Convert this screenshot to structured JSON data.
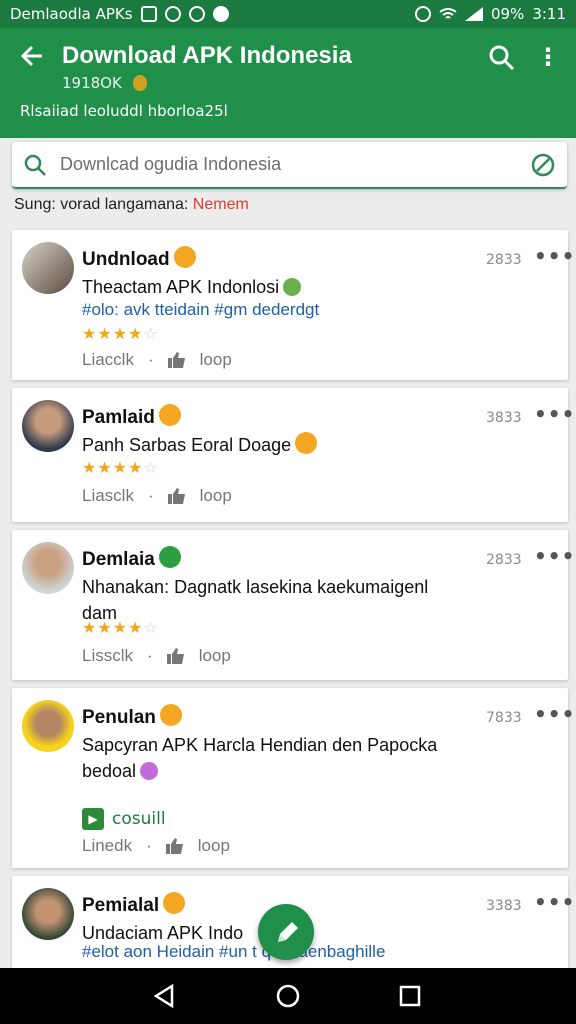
{
  "status": {
    "left_text": "Demlaodla APKs",
    "battery": "09%",
    "time": "3:11"
  },
  "appbar": {
    "title": "Download APK Indonesia",
    "subtitle": "1918OK",
    "description": "Rlsaiiad leoluddl hborloa25l"
  },
  "search": {
    "placeholder": "Downlcad ogudia Indonesia"
  },
  "filter": {
    "label": "Sung: vorad langamana:",
    "value": "Nemem"
  },
  "posts": [
    {
      "name": "Undnload",
      "date": "2833",
      "text": "Theactam APK Indonlosi",
      "tags": "#olo: avk tteidain #gm dederdgt",
      "rating": 4,
      "action_label": "Liacclk",
      "like_label": "loop"
    },
    {
      "name": "Pamlaid",
      "date": "3833",
      "text": "Panh Sarbas Eoral Doage",
      "rating": 4,
      "action_label": "Liasclk",
      "like_label": "loop"
    },
    {
      "name": "Demlaia",
      "date": "2833",
      "text": "Nhanakan: Dagnatk lasekina kaekumaigenl dam",
      "rating": 4,
      "action_label": "Lissclk",
      "like_label": "loop"
    },
    {
      "name": "Penulan",
      "date": "7833",
      "text": "Sapcyran APK Harcla Hendian den Papocka bedoal",
      "link_label": "cosuill",
      "action_label": "Linedk",
      "like_label": "loop"
    },
    {
      "name": "Pemialal",
      "date": "3383",
      "text": "Undaciam APK Indo",
      "tags": "#elot aon Heidain #un t qaukaenbaghille"
    }
  ],
  "colors": {
    "primary": "#1f8f4a",
    "status_bar": "#1a7a40",
    "link": "#1f5fa8",
    "star": "#f2a71b",
    "highlight": "#e53935"
  }
}
